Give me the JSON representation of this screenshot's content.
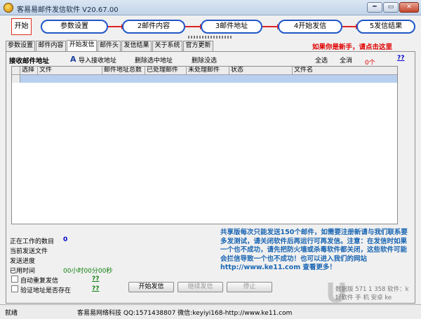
{
  "window": {
    "title": "客易易邮件发信软件 V20.67.00",
    "min": "━",
    "max": "▭",
    "close": "✕"
  },
  "steps": {
    "start": "开始",
    "items": [
      "参数设置",
      "2邮件内容",
      "3邮件地址",
      "4开始发信",
      "5发信结果"
    ]
  },
  "tabs": [
    "参数设置",
    "邮件内容",
    "开始发信",
    "邮件头",
    "发信结果",
    "关于系统",
    "官方更新"
  ],
  "newbie_link": "如果你是新手，请点击这里",
  "toolbar": {
    "section_title": "接收邮件地址",
    "import": "导入接收地址",
    "delete_selected": "删除选中地址",
    "delete_unselected": "删除没选",
    "select_all": "全选",
    "clear_all": "全消",
    "count": "0个",
    "help": "??"
  },
  "grid": {
    "columns": [
      "选择",
      "文件",
      "邮件地址总数",
      "已处理邮件",
      "未处理邮件",
      "状态",
      "文件名"
    ]
  },
  "status_area": {
    "working_label": "正在工作的数目",
    "working_value": "0",
    "current_file_label": "当前发送文件",
    "progress_label": "发送进度",
    "elapsed_label": "已用时间",
    "elapsed_value": "00小时00分00秒",
    "auto_repeat": "自动重复发信",
    "verify_address": "验证地址是否存在",
    "help1": "??",
    "help2": "??"
  },
  "buttons": {
    "start": "开始发信",
    "continue": "继续发信",
    "stop": "停止"
  },
  "info_text": "共享版每次只能发送150个邮件，如需要注册新请与我们联系要多发测试，请关闭软件后再运行可再发信。注意：在发信时如果一个也不成功，请先把防火墙或杀毒软件都关闭，这些软件可能会拦信导致一个也不成功！也可以进入我们的网站 http://www.ke11.com 查看更多！",
  "statusbar": {
    "left": "就绪",
    "company": "客易易网络科技 QQ:1571438807 微信:keyiyi168-http://www.ke11.com"
  },
  "watermark": {
    "line1": "数据版    571 1 358  软件：k",
    "line2": "好软件 手 机 安卓 ke"
  }
}
